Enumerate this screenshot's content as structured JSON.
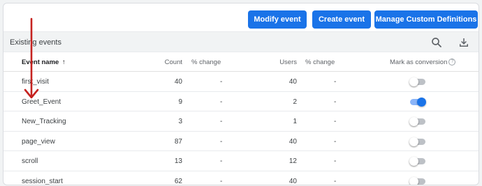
{
  "toolbar": {
    "modify_label": "Modify event",
    "create_label": "Create event",
    "manage_label": "Manage Custom Definitions"
  },
  "section": {
    "title": "Existing events",
    "search_icon": "search-icon",
    "download_icon": "download-icon"
  },
  "columns": {
    "event_name": "Event name",
    "sort_indicator": "↑",
    "count": "Count",
    "count_change": "% change",
    "users": "Users",
    "users_change": "% change",
    "mark_conversion": "Mark as conversion",
    "help": "?"
  },
  "rows": [
    {
      "name": "first_visit",
      "count": "40",
      "count_change": "-",
      "users": "40",
      "users_change": "-",
      "conversion": false
    },
    {
      "name": "Greet_Event",
      "count": "9",
      "count_change": "-",
      "users": "2",
      "users_change": "-",
      "conversion": true
    },
    {
      "name": "New_Tracking",
      "count": "3",
      "count_change": "-",
      "users": "1",
      "users_change": "-",
      "conversion": false
    },
    {
      "name": "page_view",
      "count": "87",
      "count_change": "-",
      "users": "40",
      "users_change": "-",
      "conversion": false
    },
    {
      "name": "scroll",
      "count": "13",
      "count_change": "-",
      "users": "12",
      "users_change": "-",
      "conversion": false
    },
    {
      "name": "session_start",
      "count": "62",
      "count_change": "-",
      "users": "40",
      "users_change": "-",
      "conversion": false
    }
  ],
  "colors": {
    "primary": "#1a73e8",
    "annotation_arrow": "#c5221f",
    "toggle_off": "#bdc1c6",
    "toggle_on_track": "#8ab4f8"
  }
}
